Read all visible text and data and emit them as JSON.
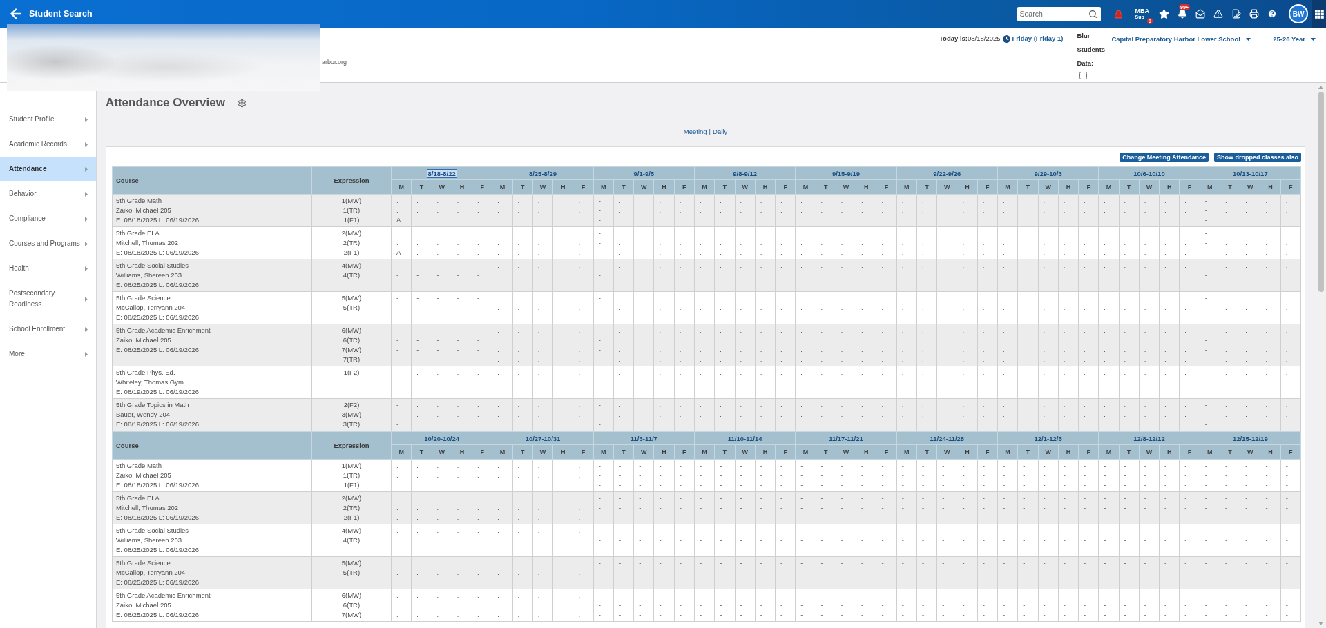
{
  "top_bar": {
    "title": "Student Search",
    "search": {
      "placeholder": "Search"
    },
    "support": {
      "lines": [
        "MBA",
        "Sup"
      ],
      "badge": "9"
    },
    "notifications": {
      "badge": "99+"
    },
    "avatar": {
      "initials": "BW"
    }
  },
  "header": {
    "email_fragment": "arbor.org",
    "today": "**Today is:**08/18/2025",
    "day_link": "Friday (Friday 1)",
    "blur_students": {
      "label": "Blur Students Data:",
      "checked": false
    },
    "school_select": "Capital Preparatory Harbor Lower School",
    "year_select": "25-26 Year"
  },
  "sidebar": {
    "items": [
      {
        "label": "Student Profile",
        "selected": false
      },
      {
        "label": "Academic Records",
        "selected": false
      },
      {
        "label": "Attendance",
        "selected": true
      },
      {
        "label": "Behavior",
        "selected": false
      },
      {
        "label": "Compliance",
        "selected": false
      },
      {
        "label": "Courses and Programs",
        "selected": false
      },
      {
        "label": "Health",
        "selected": false
      },
      {
        "label": "Postsecondary Readiness",
        "selected": false
      },
      {
        "label": "School Enrollment",
        "selected": false
      },
      {
        "label": "More",
        "selected": false
      }
    ]
  },
  "main": {
    "title": "Attendance Overview",
    "view_links": [
      "Meeting",
      "Daily"
    ],
    "view_separator": "|",
    "buttons": [
      "Change Meeting Attendance",
      "Show dropped classes also"
    ],
    "blocks": [
      {
        "columns": [
          "Course",
          "Expression"
        ],
        "weeks": [
          {
            "label": "8/18-8/22",
            "selected": true,
            "days": [
              "M",
              "T",
              "W",
              "H",
              "F"
            ]
          },
          {
            "label": "8/25-8/29",
            "selected": false,
            "days": [
              "M",
              "T",
              "W",
              "H",
              "F"
            ]
          },
          {
            "label": "9/1-9/5",
            "selected": false,
            "days": [
              "M",
              "T",
              "W",
              "H",
              "F"
            ]
          },
          {
            "label": "9/8-9/12",
            "selected": false,
            "days": [
              "M",
              "T",
              "W",
              "H",
              "F"
            ]
          },
          {
            "label": "9/15-9/19",
            "selected": false,
            "days": [
              "M",
              "T",
              "W",
              "H",
              "F"
            ]
          },
          {
            "label": "9/22-9/26",
            "selected": false,
            "days": [
              "M",
              "T",
              "W",
              "H",
              "F"
            ]
          },
          {
            "label": "9/29-10/3",
            "selected": false,
            "days": [
              "M",
              "T",
              "W",
              "H",
              "F"
            ]
          },
          {
            "label": "10/6-10/10",
            "selected": false,
            "days": [
              "M",
              "T",
              "W",
              "H",
              "F"
            ]
          },
          {
            "label": "10/13-10/17",
            "selected": false,
            "days": [
              "M",
              "T",
              "W",
              "H",
              "F"
            ]
          }
        ],
        "rows": [
          {
            "course": "5th Grade Math",
            "teacher": "Zaiko, Michael 205",
            "dates": "E: 08/18/2025 L: 06/19/2026",
            "expressions": [
              "1(MW)",
              "1(TR)",
              "1(F1)"
            ],
            "marks": [
              [
                ".\n.\nA",
                ".\n.\n.",
                ".\n.\n.",
                ".\n.\n.",
                ".\n.\n."
              ],
              [
                ".\n.\n.",
                ".\n.\n.",
                ".\n.\n.",
                ".\n.\n.",
                ".\n.\n."
              ],
              [
                "-\n-\n-",
                ".\n.\n.",
                ".\n.\n.",
                ".\n.\n.",
                ".\n.\n."
              ],
              [
                ".\n.\n.",
                ".\n.\n.",
                ".\n.\n.",
                ".\n.\n.",
                ".\n.\n."
              ],
              [
                ".\n.\n.",
                ".\n.\n.",
                ".\n.\n.",
                ".\n.\n.",
                ".\n.\n."
              ],
              [
                ".\n.\n.",
                ".\n.\n.",
                ".\n.\n.",
                ".\n.\n.",
                ".\n.\n."
              ],
              [
                ".\n.\n.",
                ".\n.\n.",
                ".\n.\n.",
                ".\n.\n.",
                ".\n.\n."
              ],
              [
                ".\n.\n.",
                ".\n.\n.",
                ".\n.\n.",
                ".\n.\n.",
                ".\n.\n."
              ],
              [
                "-\n-\n-",
                ".\n.\n.",
                ".\n.\n.",
                ".\n.\n.",
                ".\n.\n."
              ]
            ]
          },
          {
            "course": "5th Grade ELA",
            "teacher": "Mitchell, Thomas 202",
            "dates": "E: 08/18/2025 L: 06/19/2026",
            "expressions": [
              "2(MW)",
              "2(TR)",
              "2(F1)"
            ],
            "marks": [
              [
                ".\n.\nA",
                ".\n.\n.",
                ".\n.\n.",
                ".\n.\n.",
                ".\n.\n."
              ],
              [
                ".\n.\n.",
                ".\n.\n.",
                ".\n.\n.",
                ".\n.\n.",
                ".\n.\n."
              ],
              [
                "-\n-\n-",
                ".\n.\n.",
                ".\n.\n.",
                ".\n.\n.",
                ".\n.\n."
              ],
              [
                ".\n.\n.",
                ".\n.\n.",
                ".\n.\n.",
                ".\n.\n.",
                ".\n.\n."
              ],
              [
                ".\n.\n.",
                ".\n.\n.",
                ".\n.\n.",
                ".\n.\n.",
                ".\n.\n."
              ],
              [
                ".\n.\n.",
                ".\n.\n.",
                ".\n.\n.",
                ".\n.\n.",
                ".\n.\n."
              ],
              [
                ".\n.\n.",
                ".\n.\n.",
                ".\n.\n.",
                ".\n.\n.",
                ".\n.\n."
              ],
              [
                ".\n.\n.",
                ".\n.\n.",
                ".\n.\n.",
                ".\n.\n.",
                ".\n.\n."
              ],
              [
                "-\n-\n-",
                ".\n.\n.",
                ".\n.\n.",
                ".\n.\n.",
                ".\n.\n."
              ]
            ]
          },
          {
            "course": "5th Grade Social Studies",
            "teacher": "Williams, Shereen 203",
            "dates": "E: 08/25/2025 L: 06/19/2026",
            "expressions": [
              "4(MW)",
              "4(TR)"
            ],
            "marks": [
              [
                "-\n-",
                "-\n-",
                "-\n-",
                "-\n-",
                "-\n-"
              ],
              [
                ".\n.",
                ".\n.",
                ".\n.",
                ".\n.",
                ".\n."
              ],
              [
                "-\n-",
                ".\n.",
                ".\n.",
                ".\n.",
                ".\n."
              ],
              [
                ".\n.",
                ".\n.",
                ".\n.",
                ".\n.",
                ".\n."
              ],
              [
                ".\n.",
                ".\n.",
                ".\n.",
                ".\n.",
                ".\n."
              ],
              [
                ".\n.",
                ".\n.",
                ".\n.",
                ".\n.",
                ".\n."
              ],
              [
                ".\n.",
                ".\n.",
                ".\n.",
                ".\n.",
                ".\n."
              ],
              [
                ".\n.",
                ".\n.",
                ".\n.",
                ".\n.",
                ".\n."
              ],
              [
                "-\n-",
                ".\n.",
                ".\n.",
                ".\n.",
                ".\n."
              ]
            ]
          },
          {
            "course": "5th Grade Science",
            "teacher": "McCallop, Terryann 204",
            "dates": "E: 08/25/2025 L: 06/19/2026",
            "expressions": [
              "5(MW)",
              "5(TR)"
            ],
            "marks": [
              [
                "-\n-",
                "-\n-",
                "-\n-",
                "-\n-",
                "-\n-"
              ],
              [
                ".\n.",
                ".\n.",
                ".\n.",
                ".\n.",
                ".\n."
              ],
              [
                "-\n-",
                ".\n.",
                ".\n.",
                ".\n.",
                ".\n."
              ],
              [
                ".\n.",
                ".\n.",
                ".\n.",
                ".\n.",
                ".\n."
              ],
              [
                ".\n.",
                ".\n.",
                ".\n.",
                ".\n.",
                ".\n."
              ],
              [
                ".\n.",
                ".\n.",
                ".\n.",
                ".\n.",
                ".\n."
              ],
              [
                ".\n.",
                ".\n.",
                ".\n.",
                ".\n.",
                ".\n."
              ],
              [
                ".\n.",
                ".\n.",
                ".\n.",
                ".\n.",
                ".\n."
              ],
              [
                "-\n-",
                ".\n.",
                ".\n.",
                ".\n.",
                ".\n."
              ]
            ]
          },
          {
            "course": "5th Grade Academic Enrichment",
            "teacher": "Zaiko, Michael 205",
            "dates": "E: 08/25/2025 L: 06/19/2026",
            "expressions": [
              "6(MW)",
              "6(TR)",
              "7(MW)",
              "7(TR)"
            ],
            "marks": [
              [
                "-\n-\n-\n-",
                "-\n-\n-\n-",
                "-\n-\n-\n-",
                "-\n-\n-\n-",
                "-\n-\n-\n-"
              ],
              [
                ".\n.\n.\n.",
                ".\n.\n.\n.",
                ".\n.\n.\n.",
                ".\n.\n.\n.",
                ".\n.\n.\n."
              ],
              [
                "-\n-\n-\n-",
                ".\n.\n.\n.",
                ".\n.\n.\n.",
                ".\n.\n.\n.",
                ".\n.\n.\n."
              ],
              [
                ".\n.\n.\n.",
                ".\n.\n.\n.",
                ".\n.\n.\n.",
                ".\n.\n.\n.",
                ".\n.\n.\n."
              ],
              [
                ".\n.\n.\n.",
                ".\n.\n.\n.",
                ".\n.\n.\n.",
                ".\n.\n.\n.",
                ".\n.\n.\n."
              ],
              [
                ".\n.\n.\n.",
                ".\n.\n.\n.",
                ".\n.\n.\n.",
                ".\n.\n.\n.",
                ".\n.\n.\n."
              ],
              [
                ".\n.\n.\n.",
                ".\n.\n.\n.",
                ".\n.\n.\n.",
                ".\n.\n.\n.",
                ".\n.\n.\n."
              ],
              [
                ".\n.\n.\n.",
                ".\n.\n.\n.",
                ".\n.\n.\n.",
                ".\n.\n.\n.",
                ".\n.\n.\n."
              ],
              [
                "-\n-\n-\n-",
                ".\n.\n.\n.",
                ".\n.\n.\n.",
                ".\n.\n.\n.",
                ".\n.\n.\n."
              ]
            ]
          },
          {
            "course": "5th Grade Phys. Ed.",
            "teacher": "Whiteley, Thomas Gym",
            "dates": "E: 08/19/2025 L: 06/19/2026",
            "expressions": [
              "1(F2)"
            ],
            "marks": [
              [
                "-",
                ".",
                ".",
                ".",
                "."
              ],
              [
                ".",
                ".",
                ".",
                ".",
                "."
              ],
              [
                "-",
                ".",
                ".",
                ".",
                "."
              ],
              [
                ".",
                ".",
                ".",
                ".",
                "."
              ],
              [
                ".",
                ".",
                ".",
                ".",
                "."
              ],
              [
                ".",
                ".",
                ".",
                ".",
                "."
              ],
              [
                ".",
                ".",
                ".",
                ".",
                "."
              ],
              [
                ".",
                ".",
                ".",
                ".",
                "."
              ],
              [
                "-",
                ".",
                ".",
                ".",
                "."
              ]
            ]
          },
          {
            "course": "5th Grade Topics in Math",
            "teacher": "Bauer, Wendy 204",
            "dates": "E: 08/19/2025 L: 06/19/2026",
            "expressions": [
              "2(F2)",
              "3(MW)",
              "3(TR)"
            ],
            "marks": [
              [
                "-\n-\n-",
                ".\n.\n.",
                ".\n.\n.",
                ".\n.\n.",
                ".\n.\n."
              ],
              [
                ".\n.\n.",
                ".\n.\n.",
                ".\n.\n.",
                ".\n.\n.",
                ".\n.\n."
              ],
              [
                "-\n-\n-",
                ".\n.\n.",
                ".\n.\n.",
                ".\n.\n.",
                ".\n.\n."
              ],
              [
                ".\n.\n.",
                ".\n.\n.",
                ".\n.\n.",
                ".\n.\n.",
                ".\n.\n."
              ],
              [
                ".\n.\n.",
                ".\n.\n.",
                ".\n.\n.",
                ".\n.\n.",
                ".\n.\n."
              ],
              [
                ".\n.\n.",
                ".\n.\n.",
                ".\n.\n.",
                ".\n.\n.",
                ".\n.\n."
              ],
              [
                ".\n.\n.",
                ".\n.\n.",
                ".\n.\n.",
                ".\n.\n.",
                ".\n.\n."
              ],
              [
                ".\n.\n.",
                ".\n.\n.",
                ".\n.\n.",
                ".\n.\n.",
                ".\n.\n."
              ],
              [
                "-\n-\n-",
                ".\n.\n.",
                ".\n.\n.",
                ".\n.\n.",
                ".\n.\n."
              ]
            ]
          }
        ]
      },
      {
        "columns": [
          "Course",
          "Expression"
        ],
        "weeks": [
          {
            "label": "10/20-10/24",
            "selected": false,
            "days": [
              "M",
              "T",
              "W",
              "H",
              "F"
            ]
          },
          {
            "label": "10/27-10/31",
            "selected": false,
            "days": [
              "M",
              "T",
              "W",
              "H",
              "F"
            ]
          },
          {
            "label": "11/3-11/7",
            "selected": false,
            "days": [
              "M",
              "T",
              "W",
              "H",
              "F"
            ]
          },
          {
            "label": "11/10-11/14",
            "selected": false,
            "days": [
              "M",
              "T",
              "W",
              "H",
              "F"
            ]
          },
          {
            "label": "11/17-11/21",
            "selected": false,
            "days": [
              "M",
              "T",
              "W",
              "H",
              "F"
            ]
          },
          {
            "label": "11/24-11/28",
            "selected": false,
            "days": [
              "M",
              "T",
              "W",
              "H",
              "F"
            ]
          },
          {
            "label": "12/1-12/5",
            "selected": false,
            "days": [
              "M",
              "T",
              "W",
              "H",
              "F"
            ]
          },
          {
            "label": "12/8-12/12",
            "selected": false,
            "days": [
              "M",
              "T",
              "W",
              "H",
              "F"
            ]
          },
          {
            "label": "12/15-12/19",
            "selected": false,
            "days": [
              "M",
              "T",
              "W",
              "H",
              "F"
            ]
          }
        ],
        "rows": [
          {
            "course": "5th Grade Math",
            "teacher": "Zaiko, Michael 205",
            "dates": "E: 08/18/2025 L: 06/19/2026",
            "expressions": [
              "1(MW)",
              "1(TR)",
              "1(F1)"
            ],
            "marks": [
              [
                ".\n.\n.",
                ".\n.\n.",
                ".\n.\n.",
                ".\n.\n.",
                ".\n.\n."
              ],
              [
                ".\n.\n.",
                ".\n.\n.",
                ".\n.\n.",
                ".\n.\n.",
                ".\n.\n."
              ],
              [
                "-\n-\n-",
                "-\n-\n-",
                "-\n-\n-",
                "-\n-\n-",
                "-\n-\n-"
              ],
              [
                "-\n-\n-",
                "-\n-\n-",
                "-\n-\n-",
                "-\n-\n-",
                "-\n-\n-"
              ],
              [
                "-\n-\n-",
                "-\n-\n-",
                "-\n-\n-",
                "-\n-\n-",
                "-\n-\n-"
              ],
              [
                "-\n-\n-",
                "-\n-\n-",
                "-\n-\n-",
                "-\n-\n-",
                "-\n-\n-"
              ],
              [
                "-\n-\n-",
                "-\n-\n-",
                "-\n-\n-",
                "-\n-\n-",
                "-\n-\n-"
              ],
              [
                "-\n-\n-",
                "-\n-\n-",
                "-\n-\n-",
                "-\n-\n-",
                "-\n-\n-"
              ],
              [
                "-\n-\n-",
                "-\n-\n-",
                "-\n-\n-",
                "-\n-\n-",
                "-\n-\n-"
              ]
            ]
          },
          {
            "course": "5th Grade ELA",
            "teacher": "Mitchell, Thomas 202",
            "dates": "E: 08/18/2025 L: 06/19/2026",
            "expressions": [
              "2(MW)",
              "2(TR)",
              "2(F1)"
            ],
            "marks": [
              [
                ".\n.\n.",
                ".\n.\n.",
                ".\n.\n.",
                ".\n.\n.",
                ".\n.\n."
              ],
              [
                ".\n.\n.",
                ".\n.\n.",
                ".\n.\n.",
                ".\n.\n.",
                ".\n.\n."
              ],
              [
                "-\n-\n-",
                "-\n-\n-",
                "-\n-\n-",
                "-\n-\n-",
                "-\n-\n-"
              ],
              [
                "-\n-\n-",
                "-\n-\n-",
                "-\n-\n-",
                "-\n-\n-",
                "-\n-\n-"
              ],
              [
                "-\n-\n-",
                "-\n-\n-",
                "-\n-\n-",
                "-\n-\n-",
                "-\n-\n-"
              ],
              [
                "-\n-\n-",
                "-\n-\n-",
                "-\n-\n-",
                "-\n-\n-",
                "-\n-\n-"
              ],
              [
                "-\n-\n-",
                "-\n-\n-",
                "-\n-\n-",
                "-\n-\n-",
                "-\n-\n-"
              ],
              [
                "-\n-\n-",
                "-\n-\n-",
                "-\n-\n-",
                "-\n-\n-",
                "-\n-\n-"
              ],
              [
                "-\n-\n-",
                "-\n-\n-",
                "-\n-\n-",
                "-\n-\n-",
                "-\n-\n-"
              ]
            ]
          },
          {
            "course": "5th Grade Social Studies",
            "teacher": "Williams, Shereen 203",
            "dates": "E: 08/25/2025 L: 06/19/2026",
            "expressions": [
              "4(MW)",
              "4(TR)"
            ],
            "marks": [
              [
                ".\n.",
                ".\n.",
                ".\n.",
                ".\n.",
                ".\n."
              ],
              [
                ".\n.",
                ".\n.",
                ".\n.",
                ".\n.",
                ".\n."
              ],
              [
                "-\n-",
                "-\n-",
                "-\n-",
                "-\n-",
                "-\n-"
              ],
              [
                "-\n-",
                "-\n-",
                "-\n-",
                "-\n-",
                "-\n-"
              ],
              [
                "-\n-",
                "-\n-",
                "-\n-",
                "-\n-",
                "-\n-"
              ],
              [
                "-\n-",
                "-\n-",
                "-\n-",
                "-\n-",
                "-\n-"
              ],
              [
                "-\n-",
                "-\n-",
                "-\n-",
                "-\n-",
                "-\n-"
              ],
              [
                "-\n-",
                "-\n-",
                "-\n-",
                "-\n-",
                "-\n-"
              ],
              [
                "-\n-",
                "-\n-",
                "-\n-",
                "-\n-",
                "-\n-"
              ]
            ]
          },
          {
            "course": "5th Grade Science",
            "teacher": "McCallop, Terryann 204",
            "dates": "E: 08/25/2025 L: 06/19/2026",
            "expressions": [
              "5(MW)",
              "5(TR)"
            ],
            "marks": [
              [
                ".\n.",
                ".\n.",
                ".\n.",
                ".\n.",
                ".\n."
              ],
              [
                ".\n.",
                ".\n.",
                ".\n.",
                ".\n.",
                ".\n."
              ],
              [
                "-\n-",
                "-\n-",
                "-\n-",
                "-\n-",
                "-\n-"
              ],
              [
                "-\n-",
                "-\n-",
                "-\n-",
                "-\n-",
                "-\n-"
              ],
              [
                "-\n-",
                "-\n-",
                "-\n-",
                "-\n-",
                "-\n-"
              ],
              [
                "-\n-",
                "-\n-",
                "-\n-",
                "-\n-",
                "-\n-"
              ],
              [
                "-\n-",
                "-\n-",
                "-\n-",
                "-\n-",
                "-\n-"
              ],
              [
                "-\n-",
                "-\n-",
                "-\n-",
                "-\n-",
                "-\n-"
              ],
              [
                "-\n-",
                "-\n-",
                "-\n-",
                "-\n-",
                "-\n-"
              ]
            ]
          },
          {
            "course": "5th Grade Academic Enrichment",
            "teacher": "Zaiko, Michael 205",
            "dates": "E: 08/25/2025 L: 06/19/2026",
            "expressions": [
              "6(MW)",
              "6(TR)",
              "7(MW)"
            ],
            "marks": [
              [
                ".\n.\n.",
                ".\n.\n.",
                ".\n.\n.",
                ".\n.\n.",
                ".\n.\n."
              ],
              [
                ".\n.\n.",
                ".\n.\n.",
                ".\n.\n.",
                ".\n.\n.",
                ".\n.\n."
              ],
              [
                "-\n-\n-",
                "-\n-\n-",
                "-\n-\n-",
                "-\n-\n-",
                "-\n-\n-"
              ],
              [
                "-\n-\n-",
                "-\n-\n-",
                "-\n-\n-",
                "-\n-\n-",
                "-\n-\n-"
              ],
              [
                "-\n-\n-",
                "-\n-\n-",
                "-\n-\n-",
                "-\n-\n-",
                "-\n-\n-"
              ],
              [
                "-\n-\n-",
                "-\n-\n-",
                "-\n-\n-",
                "-\n-\n-",
                "-\n-\n-"
              ],
              [
                "-\n-\n-",
                "-\n-\n-",
                "-\n-\n-",
                "-\n-\n-",
                "-\n-\n-"
              ],
              [
                "-\n-\n-",
                "-\n-\n-",
                "-\n-\n-",
                "-\n-\n-",
                "-\n-\n-"
              ],
              [
                "-\n-\n-",
                "-\n-\n-",
                "-\n-\n-",
                "-\n-\n-",
                "-\n-\n-"
              ]
            ]
          }
        ]
      }
    ]
  }
}
